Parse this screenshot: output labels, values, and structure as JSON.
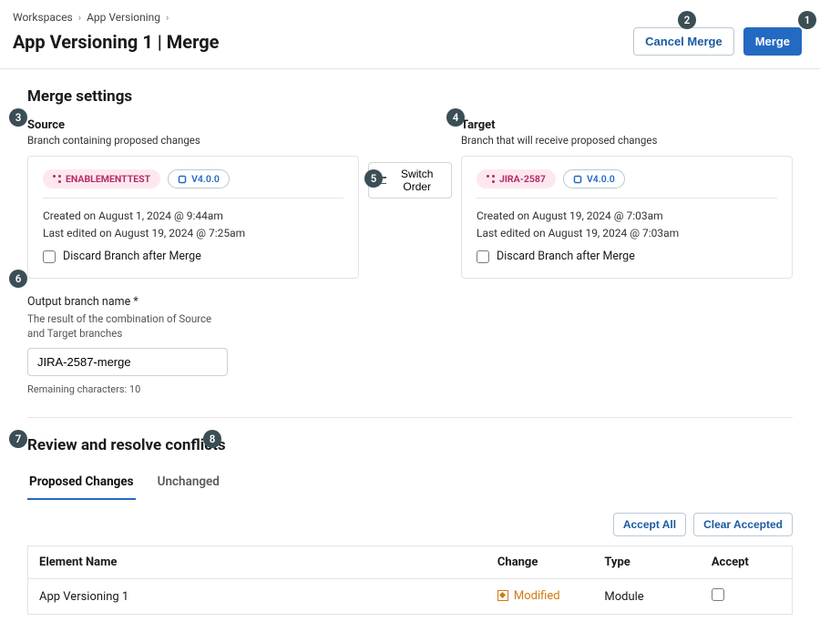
{
  "breadcrumb": {
    "root": "Workspaces",
    "app": "App Versioning"
  },
  "page_title": "App Versioning 1 | Merge",
  "header_actions": {
    "cancel": "Cancel Merge",
    "merge": "Merge"
  },
  "merge_settings": {
    "heading": "Merge settings",
    "source": {
      "title": "Source",
      "subtitle": "Branch containing proposed changes",
      "branch_pill": "ENABLEMENTTEST",
      "version_pill": "V4.0.0",
      "created": "Created on August 1, 2024 @ 9:44am",
      "edited": "Last edited on August 19, 2024 @ 7:25am",
      "discard_label": "Discard Branch after Merge"
    },
    "switch_label": "Switch Order",
    "target": {
      "title": "Target",
      "subtitle": "Branch that will receive proposed changes",
      "branch_pill": "JIRA-2587",
      "version_pill": "V4.0.0",
      "created": "Created on August 19, 2024 @ 7:03am",
      "edited": "Last edited on August 19, 2024 @ 7:03am",
      "discard_label": "Discard Branch after Merge"
    },
    "output": {
      "label": "Output branch name *",
      "help": "The result of the combination of Source and Target branches",
      "value": "JIRA-2587-merge",
      "remaining": "Remaining characters: 10"
    }
  },
  "conflicts": {
    "heading": "Review and resolve conflicts",
    "tabs": {
      "proposed": "Proposed Changes",
      "unchanged": "Unchanged"
    },
    "actions": {
      "accept_all": "Accept All",
      "clear": "Clear Accepted"
    },
    "columns": {
      "name": "Element Name",
      "change": "Change",
      "type": "Type",
      "accept": "Accept"
    },
    "rows": [
      {
        "name": "App Versioning 1",
        "change": "Modified",
        "type": "Module"
      }
    ]
  },
  "callouts": [
    "1",
    "2",
    "3",
    "4",
    "5",
    "6",
    "7",
    "8"
  ]
}
